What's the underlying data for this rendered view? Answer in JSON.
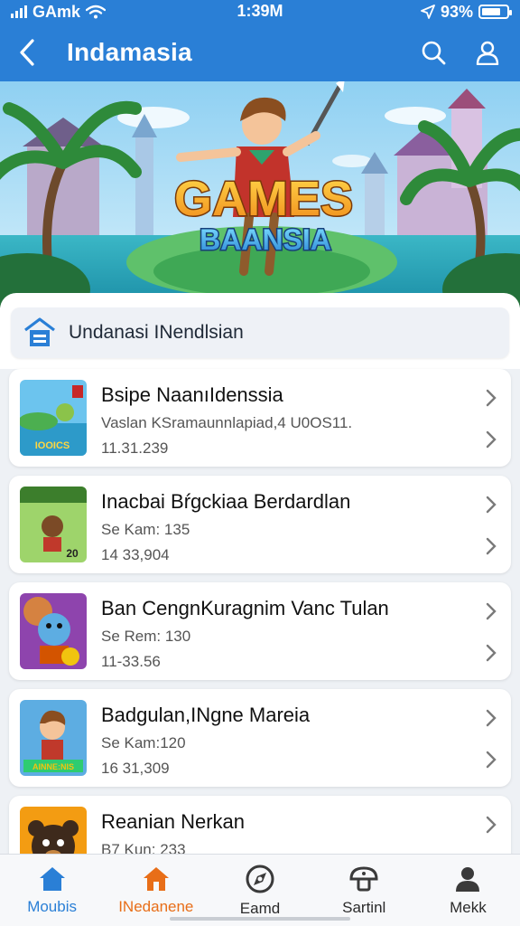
{
  "status_bar": {
    "carrier": "GAmk",
    "time": "1:39M",
    "battery": "93%"
  },
  "header": {
    "title": "Indamasia"
  },
  "hero": {
    "logo_line1": "GAMES",
    "logo_line2": "BAANSIA"
  },
  "section": {
    "label": "Undanasi INendlsian"
  },
  "games": [
    {
      "title": "Bsipe NaanıIdenssia",
      "subtitle": "Vaslan KSramaunnlapiad,4 U0OS11.",
      "number": "11.31.239",
      "thumb_caption": "IOOICS"
    },
    {
      "title": "Inacbai Bŕgckiaa Berdardlan",
      "subtitle": "Se Kam: 135",
      "number": "14 33,904",
      "thumb_caption": "20"
    },
    {
      "title": "Ban CengnKuragnim Vanc Tulan",
      "subtitle": "Se Rem: 130",
      "number": "11-33.56",
      "thumb_caption": ""
    },
    {
      "title": "Badgulan,INgne Mareia",
      "subtitle": "Se Kam:120",
      "number": "16 31,309",
      "thumb_caption": "AINNE:NIS"
    },
    {
      "title": "Reanian Nerkan",
      "subtitle": "B7 Kun: 233",
      "number": "",
      "thumb_caption": ""
    }
  ],
  "tabs": [
    {
      "label": "Moubis",
      "icon": "home-icon",
      "color": "#2a7fd6"
    },
    {
      "label": "INedanene",
      "icon": "house-icon",
      "color": "#e86e18"
    },
    {
      "label": "Eamd",
      "icon": "compass-icon",
      "color": "#2b2b2b"
    },
    {
      "label": "Sartinl",
      "icon": "mushroom-icon",
      "color": "#2b2b2b"
    },
    {
      "label": "Mekk",
      "icon": "profile-icon",
      "color": "#2b2b2b"
    }
  ],
  "colors": {
    "header": "#2a7fd6",
    "accent_orange": "#e86e18",
    "background": "#eef1f5"
  }
}
